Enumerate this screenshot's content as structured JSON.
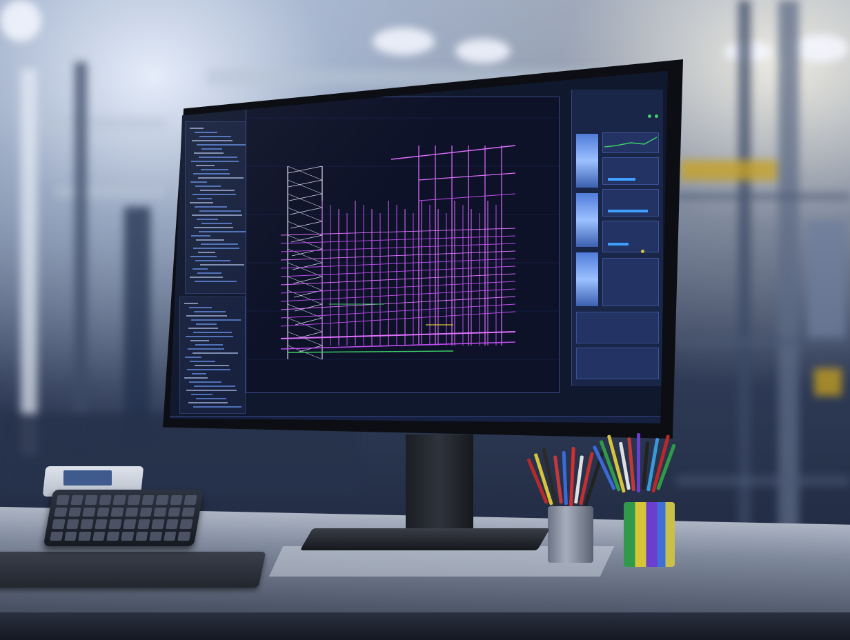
{
  "scene": {
    "subject": "desktop-monitor-showing-cad-software",
    "setting": "industrial-workshop-office",
    "colors": {
      "wireframe_primary": "#c04cf0",
      "wireframe_secondary": "#e070ff",
      "wireframe_structure": "#d8d8f0",
      "accent_green": "#3fd06a",
      "accent_yellow": "#d8c43a",
      "ui_blue": "#3ea0ff",
      "screen_background": "#10182e"
    }
  }
}
